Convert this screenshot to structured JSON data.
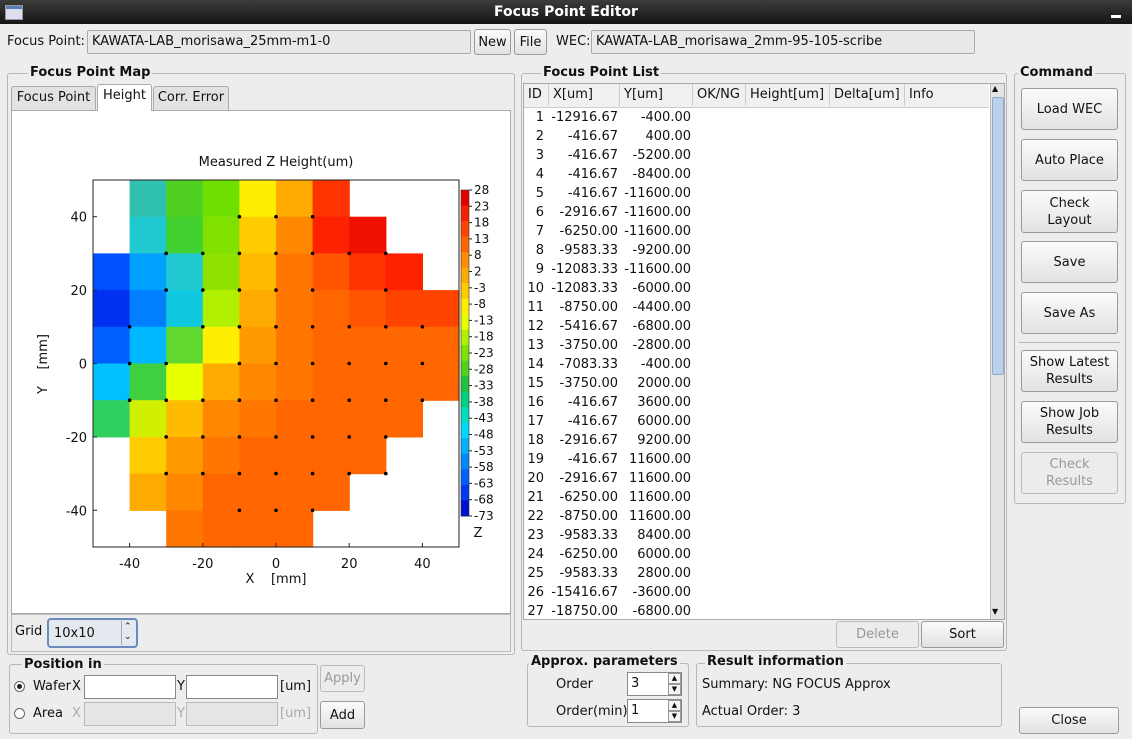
{
  "window": {
    "title": "Focus Point Editor"
  },
  "top": {
    "focus_point_label": "Focus Point:",
    "focus_point_value": "KAWATA-LAB_morisawa_25mm-m1-0",
    "new_label": "New",
    "file_label": "File",
    "wec_label": "WEC:",
    "wec_value": "KAWATA-LAB_morisawa_2mm-95-105-scribe"
  },
  "map_panel": {
    "title": "Focus Point Map",
    "tabs": [
      "Focus Point",
      "Height",
      "Corr. Error"
    ],
    "active_tab": "Height",
    "grid_label": "Grid",
    "grid_value": "10x10"
  },
  "chart_data": {
    "type": "heatmap",
    "title": "Measured Z Height(um)",
    "xlabel": "X    [mm]",
    "ylabel": "Y    [mm]",
    "xlim": [
      -50,
      50
    ],
    "ylim": [
      -50,
      50
    ],
    "x_ticks": [
      "-40",
      "-20",
      "0",
      "20",
      "40"
    ],
    "y_ticks": [
      "40",
      "20",
      "0",
      "-20",
      "-40"
    ],
    "colorbar_label": "Z",
    "colorbar_ticks": [
      "28",
      "23",
      "18",
      "13",
      "8",
      "2",
      "-3",
      "-8",
      "-13",
      "-18",
      "-23",
      "-28",
      "-33",
      "-38",
      "-43",
      "-48",
      "-53",
      "-58",
      "-63",
      "-68",
      "-73"
    ],
    "colorbar_colors": [
      "#e00000",
      "#f42000",
      "#ff4400",
      "#ff6600",
      "#ff8c00",
      "#ffaa00",
      "#ffcc00",
      "#ffee00",
      "#e8ff00",
      "#b0f000",
      "#80e000",
      "#50d020",
      "#20c040",
      "#00d080",
      "#00e0c0",
      "#00d8ff",
      "#00b0ff",
      "#0088ff",
      "#0060ff",
      "#0038f0",
      "#0010d0"
    ],
    "cells": [
      [
        null,
        "#30c0b0",
        "#50d020",
        "#70e000",
        "#ffee00",
        "#ffaa00",
        "#ff3300",
        null,
        null,
        null
      ],
      [
        null,
        "#20c8d0",
        "#40d030",
        "#80e000",
        "#ffcc00",
        "#ff8800",
        "#ff2200",
        "#ee1100",
        null,
        null
      ],
      [
        "#0050ff",
        "#00a0ff",
        "#20c8d0",
        "#90e000",
        "#ffbb00",
        "#ff7700",
        "#ff5500",
        "#ff3300",
        "#ff2200",
        null
      ],
      [
        "#0030f0",
        "#0080ff",
        "#10c8e0",
        "#b0f000",
        "#ffaa00",
        "#ff7700",
        "#ff6600",
        "#ff5500",
        "#ff4400",
        "#ff4400"
      ],
      [
        "#0060ff",
        "#00b8ff",
        "#60d830",
        "#ffee00",
        "#ff9900",
        "#ff7700",
        "#ff6600",
        "#ff6600",
        "#ff6600",
        "#ff6600"
      ],
      [
        "#00c0ff",
        "#40d040",
        "#e8ff00",
        "#ffaa00",
        "#ff8800",
        "#ff7700",
        "#ff6600",
        "#ff6600",
        "#ff6600",
        "#ff6600"
      ],
      [
        "#30d060",
        "#d0f000",
        "#ffbb00",
        "#ff8800",
        "#ff7700",
        "#ff6600",
        "#ff6600",
        "#ff6600",
        "#ff6600",
        null
      ],
      [
        null,
        "#ffcc00",
        "#ff9900",
        "#ff7700",
        "#ff6600",
        "#ff6600",
        "#ff6600",
        "#ff6600",
        null,
        null
      ],
      [
        null,
        "#ffaa00",
        "#ff8800",
        "#ff6600",
        "#ff6600",
        "#ff6600",
        "#ff6600",
        null,
        null,
        null
      ],
      [
        null,
        null,
        "#ff7700",
        "#ff6600",
        "#ff6600",
        "#ff6600",
        null,
        null,
        null,
        null
      ]
    ],
    "points": [
      [
        -10,
        40
      ],
      [
        0,
        40
      ],
      [
        10,
        40
      ],
      [
        -30,
        30
      ],
      [
        -20,
        30
      ],
      [
        -10,
        30
      ],
      [
        0,
        30
      ],
      [
        10,
        30
      ],
      [
        20,
        30
      ],
      [
        30,
        30
      ],
      [
        -30,
        20
      ],
      [
        -20,
        20
      ],
      [
        -10,
        20
      ],
      [
        0,
        20
      ],
      [
        10,
        20
      ],
      [
        30,
        20
      ],
      [
        -40,
        10
      ],
      [
        -20,
        10
      ],
      [
        -10,
        10
      ],
      [
        0,
        10
      ],
      [
        10,
        10
      ],
      [
        20,
        10
      ],
      [
        30,
        10
      ],
      [
        40,
        10
      ],
      [
        -40,
        0
      ],
      [
        -30,
        0
      ],
      [
        -10,
        0
      ],
      [
        0,
        0
      ],
      [
        10,
        0
      ],
      [
        20,
        0
      ],
      [
        30,
        0
      ],
      [
        40,
        0
      ],
      [
        -40,
        -10
      ],
      [
        -30,
        -10
      ],
      [
        -20,
        -10
      ],
      [
        -10,
        -10
      ],
      [
        0,
        -10
      ],
      [
        10,
        -10
      ],
      [
        20,
        -10
      ],
      [
        30,
        -10
      ],
      [
        40,
        -10
      ],
      [
        -30,
        -20
      ],
      [
        -20,
        -20
      ],
      [
        -10,
        -20
      ],
      [
        0,
        -20
      ],
      [
        10,
        -20
      ],
      [
        20,
        -20
      ],
      [
        30,
        -20
      ],
      [
        -30,
        -30
      ],
      [
        -20,
        -30
      ],
      [
        -10,
        -30
      ],
      [
        0,
        -30
      ],
      [
        10,
        -30
      ],
      [
        20,
        -30
      ],
      [
        30,
        -30
      ],
      [
        -10,
        -40
      ],
      [
        0,
        -40
      ],
      [
        10,
        -40
      ]
    ]
  },
  "list_panel": {
    "title": "Focus Point List",
    "headers": [
      "ID",
      "X[um]",
      "Y[um]",
      "OK/NG",
      "Height[um]",
      "Delta[um]",
      "Info"
    ],
    "rows": [
      [
        "1",
        "-12916.67",
        "-400.00"
      ],
      [
        "2",
        "-416.67",
        "400.00"
      ],
      [
        "3",
        "-416.67",
        "-5200.00"
      ],
      [
        "4",
        "-416.67",
        "-8400.00"
      ],
      [
        "5",
        "-416.67",
        "-11600.00"
      ],
      [
        "6",
        "-2916.67",
        "-11600.00"
      ],
      [
        "7",
        "-6250.00",
        "-11600.00"
      ],
      [
        "8",
        "-9583.33",
        "-9200.00"
      ],
      [
        "9",
        "-12083.33",
        "-11600.00"
      ],
      [
        "10",
        "-12083.33",
        "-6000.00"
      ],
      [
        "11",
        "-8750.00",
        "-4400.00"
      ],
      [
        "12",
        "-5416.67",
        "-6800.00"
      ],
      [
        "13",
        "-3750.00",
        "-2800.00"
      ],
      [
        "14",
        "-7083.33",
        "-400.00"
      ],
      [
        "15",
        "-3750.00",
        "2000.00"
      ],
      [
        "16",
        "-416.67",
        "3600.00"
      ],
      [
        "17",
        "-416.67",
        "6000.00"
      ],
      [
        "18",
        "-2916.67",
        "9200.00"
      ],
      [
        "19",
        "-416.67",
        "11600.00"
      ],
      [
        "20",
        "-2916.67",
        "11600.00"
      ],
      [
        "21",
        "-6250.00",
        "11600.00"
      ],
      [
        "22",
        "-8750.00",
        "11600.00"
      ],
      [
        "23",
        "-9583.33",
        "8400.00"
      ],
      [
        "24",
        "-6250.00",
        "6000.00"
      ],
      [
        "25",
        "-9583.33",
        "2800.00"
      ],
      [
        "26",
        "-15416.67",
        "-3600.00"
      ],
      [
        "27",
        "-18750.00",
        "-6800.00"
      ]
    ],
    "delete_label": "Delete",
    "sort_label": "Sort"
  },
  "command": {
    "title": "Command",
    "buttons": {
      "load_wec": "Load WEC",
      "auto_place": "Auto Place",
      "check_layout_1": "Check",
      "check_layout_2": "Layout",
      "save": "Save",
      "save_as": "Save As",
      "show_latest_1": "Show Latest",
      "show_latest_2": "Results",
      "show_job_1": "Show Job",
      "show_job_2": "Results",
      "check_results_1": "Check",
      "check_results_2": "Results"
    },
    "close_label": "Close"
  },
  "position": {
    "title": "Position in",
    "wafer_label": "Wafer",
    "area_label": "Area",
    "x_label": "X",
    "y_label": "Y",
    "unit": "[um]",
    "apply_label": "Apply",
    "add_label": "Add",
    "selected": "Wafer"
  },
  "approx": {
    "title": "Approx. parameters",
    "order_label": "Order",
    "order_value": "3",
    "order_min_label": "Order(min)",
    "order_min_value": "1"
  },
  "result": {
    "title": "Result information",
    "summary": "Summary: NG FOCUS Approx",
    "actual_order": "Actual Order: 3"
  }
}
